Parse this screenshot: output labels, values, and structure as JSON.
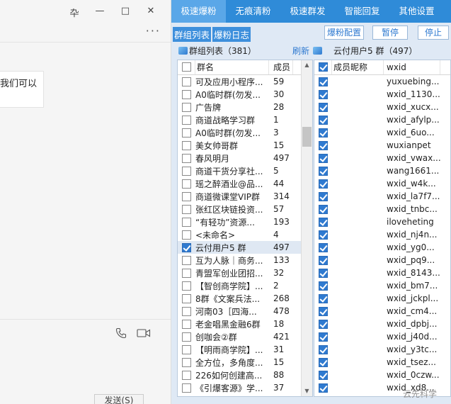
{
  "chat": {
    "window_controls": [
      "卆",
      "—",
      "□",
      "✕"
    ],
    "more_label": "···",
    "message_snippet": "我们可以",
    "send_label": "发送(S)"
  },
  "tabs": [
    {
      "label": "极速爆粉",
      "active": true
    },
    {
      "label": "无痕清粉",
      "active": false
    },
    {
      "label": "极速群发",
      "active": false
    },
    {
      "label": "智能回复",
      "active": false
    },
    {
      "label": "其他设置",
      "active": false
    }
  ],
  "subtabs": {
    "group_list": "群组列表",
    "log": "爆粉日志"
  },
  "buttons": {
    "config": "爆粉配置",
    "pause": "暂停",
    "stop": "停止"
  },
  "groups": {
    "title": "群组列表（381）",
    "refresh": "刷新",
    "col_name": "群名",
    "col_count": "成员",
    "rows": [
      {
        "name": "可及应用小程序...",
        "count": "59",
        "checked": false
      },
      {
        "name": "A0临时群(勿发...",
        "count": "30",
        "checked": false
      },
      {
        "name": "广告牌",
        "count": "28",
        "checked": false
      },
      {
        "name": "商道战略学习群",
        "count": "1",
        "checked": false
      },
      {
        "name": "A0临时群(勿发...",
        "count": "3",
        "checked": false
      },
      {
        "name": "美女帅哥群",
        "count": "15",
        "checked": false
      },
      {
        "name": "春风明月",
        "count": "497",
        "checked": false
      },
      {
        "name": "商道干货分享社...",
        "count": "5",
        "checked": false
      },
      {
        "name": "瑶之醉酒业@品...",
        "count": "44",
        "checked": false
      },
      {
        "name": "商道微课堂VIP群",
        "count": "314",
        "checked": false
      },
      {
        "name": "张红区块链投资...",
        "count": "57",
        "checked": false
      },
      {
        "name": "“有轻功”资源...",
        "count": "193",
        "checked": false
      },
      {
        "name": "<未命名>",
        "count": "4",
        "checked": false
      },
      {
        "name": "   云付用户5  群",
        "count": "497",
        "checked": true,
        "selected": true
      },
      {
        "name": "互为人脉｜商务...",
        "count": "133",
        "checked": false
      },
      {
        "name": "青盟军创业团招...",
        "count": "32",
        "checked": false
      },
      {
        "name": "【智创商学院】...",
        "count": "2",
        "checked": false
      },
      {
        "name": "8群《文案兵法...",
        "count": "268",
        "checked": false
      },
      {
        "name": "   河南03［四海...",
        "count": "478",
        "checked": false
      },
      {
        "name": "老金唱黑金融6群",
        "count": "18",
        "checked": false
      },
      {
        "name": "创咖会②群",
        "count": "421",
        "checked": false
      },
      {
        "name": "【明雨商学院】...",
        "count": "31",
        "checked": false
      },
      {
        "name": "全方位，多角度...",
        "count": "15",
        "checked": false
      },
      {
        "name": "226如何创建高...",
        "count": "88",
        "checked": false
      },
      {
        "name": "《引爆客源》学...",
        "count": "37",
        "checked": false
      }
    ]
  },
  "members": {
    "title": "云付用户5  群（497）",
    "col_nick": "成员昵称",
    "col_wxid": "wxid",
    "rows": [
      "yuxuebing...",
      "wxid_1130...",
      "wxid_xucx...",
      "wxid_afylp...",
      "wxid_6uo...",
      "wuxianpet",
      "wxid_vwax...",
      "wang1661...",
      "wxid_w4k...",
      "wxid_la7f7...",
      "wxid_tnbc...",
      "iloveheting",
      "wxid_nj4n...",
      "wxid_yg0...",
      "wxid_pq9...",
      "wxid_8143...",
      "wxid_bm7...",
      "wxid_jckpl...",
      "wxid_cm4...",
      "wxid_dpbj...",
      "wxid_j40d...",
      "wxid_y3tc...",
      "wxid_tsez...",
      "wxid_0czw...",
      "wxid_xd8..."
    ]
  },
  "watermark": "云先科学"
}
